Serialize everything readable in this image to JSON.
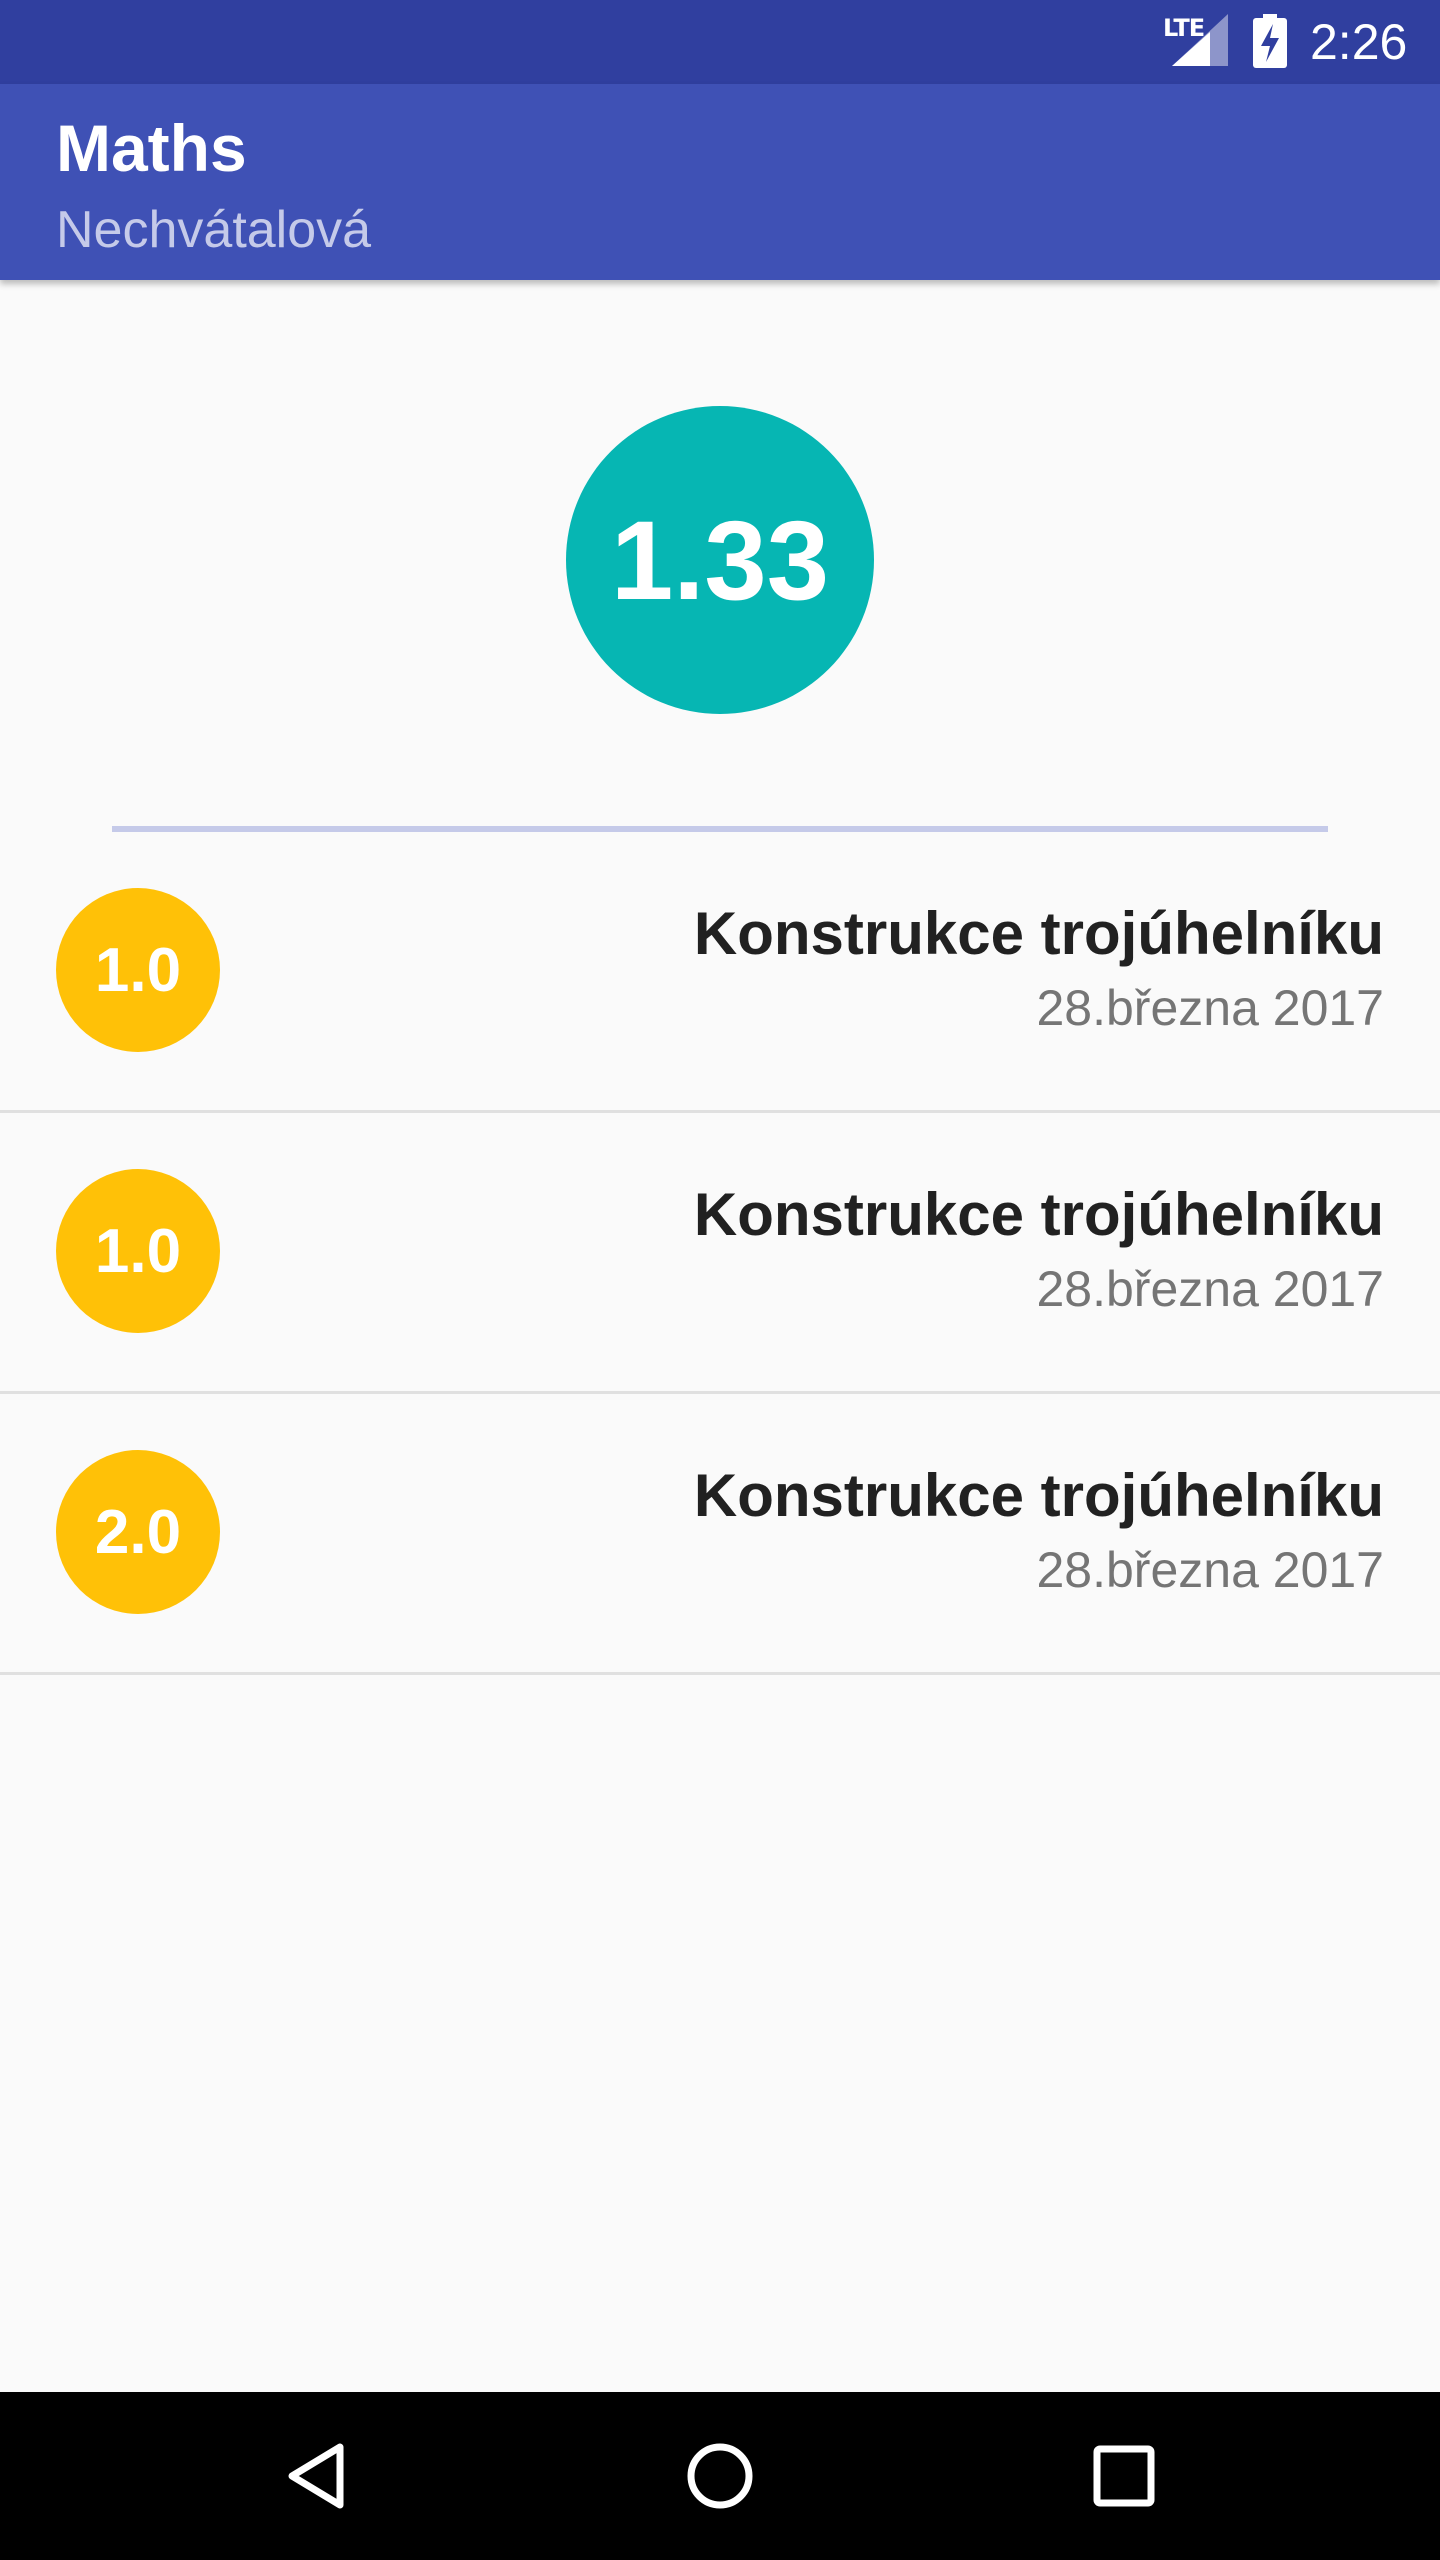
{
  "status_bar": {
    "network": "LTE",
    "time": "2:26",
    "icons": [
      "signal-icon",
      "battery-charging-icon"
    ]
  },
  "app_bar": {
    "title": "Maths",
    "subtitle": "Nechvátalová"
  },
  "average": {
    "value": "1.33"
  },
  "grades": [
    {
      "value": "1.0",
      "title": "Konstrukce trojúhelníku",
      "date": "28.března 2017"
    },
    {
      "value": "1.0",
      "title": "Konstrukce trojúhelníku",
      "date": "28.března 2017"
    },
    {
      "value": "2.0",
      "title": "Konstrukce trojúhelníku",
      "date": "28.března 2017"
    }
  ],
  "nav_bar": {
    "buttons": [
      "back-icon",
      "home-icon",
      "recents-icon"
    ]
  },
  "colors": {
    "status_bar": "#303f9f",
    "app_bar": "#3f51b5",
    "average_circle": "#06b6b3",
    "grade_badge": "#ffc107",
    "divider_accent": "#c5cae9"
  }
}
